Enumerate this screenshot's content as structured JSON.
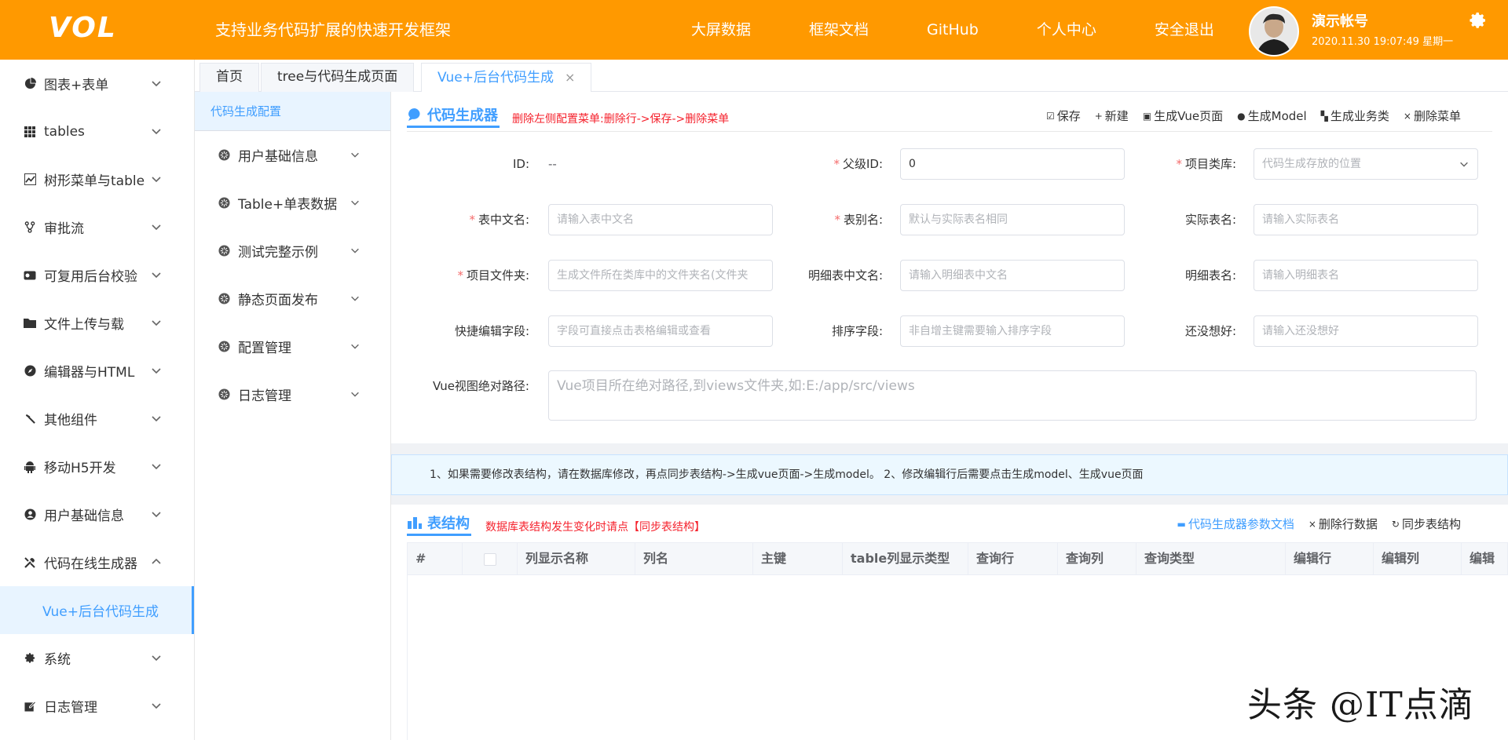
{
  "header": {
    "logo": "VOL",
    "slogan": "支持业务代码扩展的快速开发框架",
    "nav": [
      "大屏数据",
      "框架文档",
      "GitHub",
      "个人中心",
      "安全退出"
    ],
    "user_name": "演示帐号",
    "user_time": "2020.11.30 19:07:49 星期一"
  },
  "leftmenu": {
    "items": [
      {
        "label": "图表+表单",
        "icon": "pie-chart-icon"
      },
      {
        "label": "tables",
        "icon": "grid-icon"
      },
      {
        "label": "树形菜单与table",
        "icon": "line-chart-icon"
      },
      {
        "label": "审批流",
        "icon": "branch-icon"
      },
      {
        "label": "可复用后台校验",
        "icon": "toggle-icon"
      },
      {
        "label": "文件上传与载",
        "icon": "folder-icon"
      },
      {
        "label": "编辑器与HTML",
        "icon": "compass-icon"
      },
      {
        "label": "其他组件",
        "icon": "hammer-icon"
      },
      {
        "label": "移动H5开发",
        "icon": "android-icon"
      },
      {
        "label": "用户基础信息",
        "icon": "user-icon"
      },
      {
        "label": "代码在线生成器",
        "icon": "tools-icon"
      }
    ],
    "active_sub": "Vue+后台代码生成",
    "bottom_items": [
      {
        "label": "系统",
        "icon": "gear-icon"
      },
      {
        "label": "日志管理",
        "icon": "edit-icon"
      }
    ]
  },
  "tabs": [
    {
      "label": "首页"
    },
    {
      "label": "tree与代码生成页面"
    },
    {
      "label": "Vue+后台代码生成",
      "close": "×"
    }
  ],
  "subside": {
    "head": "代码生成配置",
    "items": [
      "用户基础信息",
      "Table+单表数据",
      "测试完整示例",
      "静态页面发布",
      "配置管理",
      "日志管理"
    ]
  },
  "panel1": {
    "title": "代码生成器",
    "tip": "删除左侧配置菜单:删除行->保存->删除菜单",
    "toolbar": [
      {
        "icon": "☑",
        "label": "保存"
      },
      {
        "icon": "+",
        "label": "新建"
      },
      {
        "icon": "▣",
        "label": "生成Vue页面"
      },
      {
        "icon": "●",
        "label": "生成Model"
      },
      {
        "icon": "▚",
        "label": "生成业务类"
      },
      {
        "icon": "×",
        "label": "删除菜单"
      }
    ],
    "req_mark": "*",
    "fields": {
      "id_label": "ID:",
      "id_value": "--",
      "parent_label": "父级ID:",
      "parent_value": "0",
      "lib_label": "项目类库:",
      "lib_placeholder": "代码生成存放的位置",
      "cn_label": "表中文名:",
      "cn_placeholder": "请输入表中文名",
      "alias_label": "表别名:",
      "alias_placeholder": "默认与实际表名相同",
      "real_label": "实际表名:",
      "real_placeholder": "请输入实际表名",
      "folder_label": "项目文件夹:",
      "folder_placeholder": "生成文件所在类库中的文件夹名(文件夹",
      "detail_cn_label": "明细表中文名:",
      "detail_cn_placeholder": "请输入明细表中文名",
      "detail_label": "明细表名:",
      "detail_placeholder": "请输入明细表名",
      "quick_label": "快捷编辑字段:",
      "quick_placeholder": "字段可直接点击表格编辑或查看",
      "sort_label": "排序字段:",
      "sort_placeholder": "非自增主键需要输入排序字段",
      "nothing_label": "还没想好:",
      "nothing_placeholder": "请输入还没想好",
      "vue_label": "Vue视图绝对路径:",
      "vue_placeholder": "Vue项目所在绝对路径,到views文件夹,如:E:/app/src/views"
    }
  },
  "notice": "1、如果需要修改表结构，请在数据库修改，再点同步表结构->生成vue页面->生成model。 2、修改编辑行后需要点击生成model、生成vue页面",
  "panel2": {
    "title": "表结构",
    "tip": "数据库表结构发生变化时请点【同步表结构】",
    "toolbar": [
      {
        "icon": "▬",
        "label": "代码生成器参数文档"
      },
      {
        "icon": "×",
        "label": "删除行数据"
      },
      {
        "icon": "↻",
        "label": "同步表结构"
      }
    ],
    "columns": [
      "#",
      "",
      "列显示名称",
      "列名",
      "主键",
      "table列显示类型",
      "查询行",
      "查询列",
      "查询类型",
      "编辑行",
      "编辑列",
      "编辑"
    ]
  },
  "watermark": "头条 @IT点滴",
  "colors": {
    "header": "#ff9900",
    "accent": "#409eff",
    "tip": "#f5222d"
  }
}
